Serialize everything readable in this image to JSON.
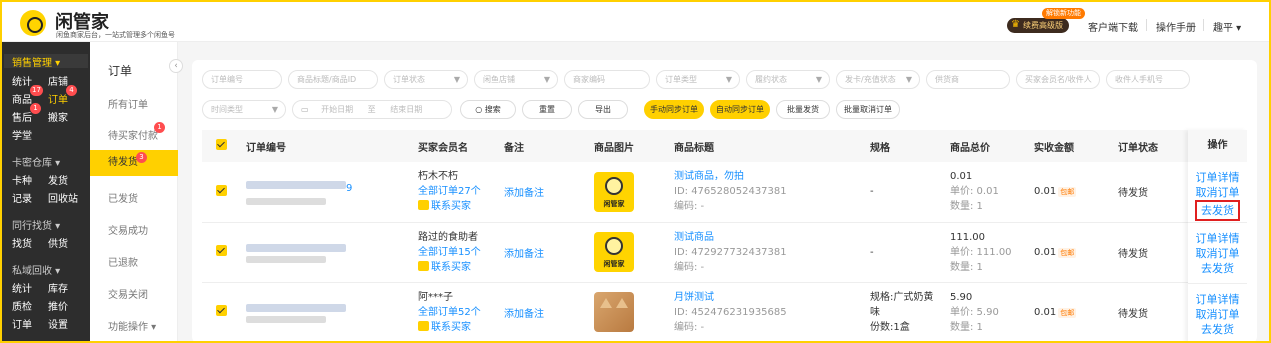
{
  "app": {
    "title": "闲管家",
    "subtitle": "闲鱼商家后台，一站式管理多个闲鱼号"
  },
  "topbar": {
    "new_feature_badge": "解锁新功能",
    "premium": "续费高级版",
    "links": [
      "客户端下载",
      "操作手册"
    ],
    "user": "趣平 ▾"
  },
  "sidenav": {
    "sections": [
      {
        "label": "销售管理 ▾",
        "items": [
          "统计",
          "店铺",
          "商品",
          "订单",
          "售后",
          "搬家",
          "学堂"
        ]
      },
      {
        "label": "卡密仓库 ▾",
        "items": [
          "卡种",
          "发货",
          "记录",
          "回收站"
        ]
      },
      {
        "label": "同行找货 ▾",
        "items": [
          "找货",
          "供货"
        ]
      },
      {
        "label": "私域回收 ▾",
        "items": [
          "统计",
          "库存",
          "质检",
          "推价",
          "订单",
          "设置"
        ]
      }
    ],
    "badges": {
      "goods": "17",
      "orders": "4",
      "after_sales": "1"
    }
  },
  "submenu": {
    "title": "订单",
    "items": [
      "所有订单",
      "待买家付款",
      "待发货",
      "已发货",
      "交易成功",
      "已退款",
      "交易关闭",
      "功能操作 ▾"
    ],
    "badges": {
      "pending_payment": "1",
      "to_ship": "3"
    }
  },
  "filters": {
    "row1": [
      "订单编号",
      "商品标题/商品ID",
      "订单状态",
      "闲鱼店铺",
      "商家编码",
      "订单类型",
      "履约状态",
      "发卡/充值状态",
      "供货商",
      "买家会员名/收件人",
      "收件人手机号"
    ],
    "time_type": "时间类型",
    "start_date": "开始日期",
    "date_sep": "至",
    "end_date": "结束日期",
    "buttons": [
      "搜索",
      "重置",
      "导出",
      "手动同步订单",
      "自动同步订单",
      "批量发货",
      "批量取消订单"
    ]
  },
  "table": {
    "headers": [
      "订单编号",
      "买家会员名",
      "备注",
      "商品图片",
      "商品标题",
      "规格",
      "商品总价",
      "实收金额",
      "订单状态",
      "操作"
    ],
    "rows": [
      {
        "order_no_tail": "9",
        "buyer": "朽木不朽",
        "all_orders": "全部订单27个",
        "contact": "联系买家",
        "remark": "添加备注",
        "image": "闲管家",
        "title": "测试商品，勿拍",
        "item_id": "ID: 476528052437381",
        "code": "编码: -",
        "spec": [
          "-"
        ],
        "total": "0.01",
        "unit": "单价: 0.01",
        "qty": "数量: 1",
        "paid": "0.01",
        "paid_tag": "包邮",
        "status": "待发货",
        "ops": [
          "订单详情",
          "取消订单",
          "去发货"
        ]
      },
      {
        "order_no_tail": "",
        "buyer": "路过的食助者",
        "all_orders": "全部订单15个",
        "contact": "联系买家",
        "remark": "添加备注",
        "image": "闲管家",
        "title": "测试商品",
        "item_id": "ID: 472927732437381",
        "code": "编码: -",
        "spec": [
          "-"
        ],
        "total": "111.00",
        "unit": "单价: 111.00",
        "qty": "数量: 1",
        "paid": "0.01",
        "paid_tag": "包邮",
        "status": "待发货",
        "ops": [
          "订单详情",
          "取消订单",
          "去发货"
        ]
      },
      {
        "order_no_tail": "",
        "buyer": "阿***子",
        "all_orders": "全部订单52个",
        "contact": "联系买家",
        "remark": "添加备注",
        "image": "",
        "title": "月饼测试",
        "item_id": "ID: 452476231935685",
        "code": "编码: -",
        "spec": [
          "规格:广式奶黄",
          "味",
          "份数:1盒"
        ],
        "total": "5.90",
        "unit": "单价: 5.90",
        "qty": "数量: 1",
        "paid": "0.01",
        "paid_tag": "包邮",
        "status": "待发货",
        "ops": [
          "订单详情",
          "取消订单",
          "去发货"
        ]
      }
    ]
  },
  "colors": {
    "brand": "#ffd000",
    "link": "#1890ff",
    "highlight_border": "#e02020",
    "nav_bg": "#2d2d2d"
  },
  "icons": [
    "logo-icon",
    "crown-icon",
    "chevron-left-icon",
    "calendar-icon",
    "search-icon",
    "contact-icon"
  ]
}
